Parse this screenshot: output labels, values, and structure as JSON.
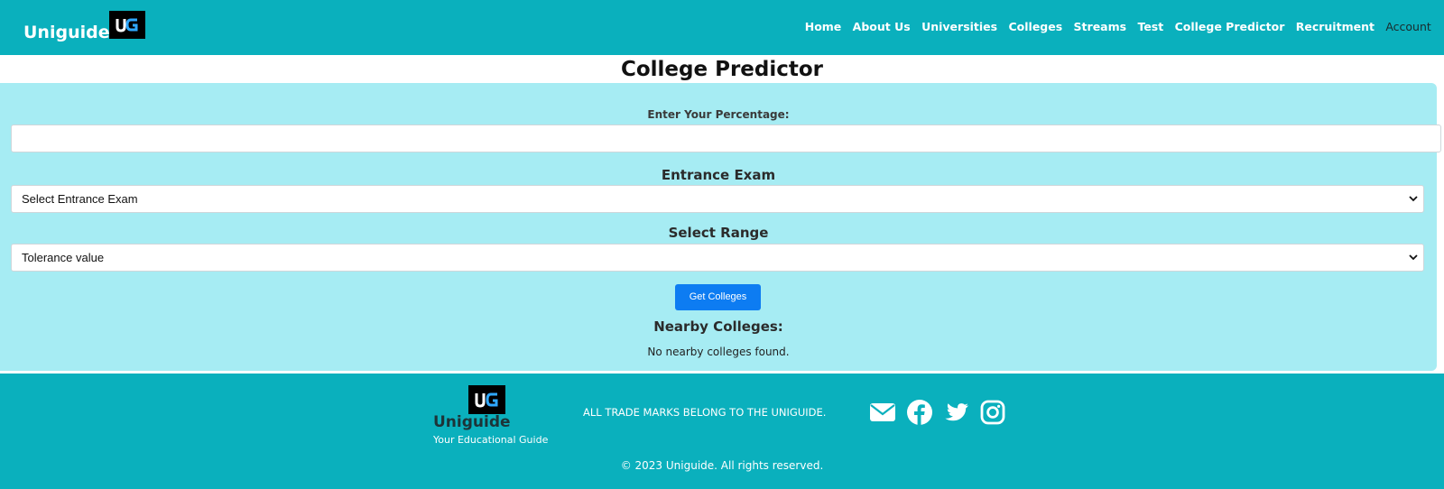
{
  "header": {
    "brand": "Uniguide",
    "logo_text": "UG",
    "nav": [
      "Home",
      "About Us",
      "Universities",
      "Colleges",
      "Streams",
      "Test",
      "College Predictor",
      "Recruitment"
    ],
    "account": "Account"
  },
  "main": {
    "title": "College Predictor",
    "percentage_label": "Enter Your Percentage:",
    "percentage_value": "",
    "exam_label": "Entrance Exam",
    "exam_selected": "Select Entrance Exam",
    "range_label": "Select Range",
    "range_selected": "Tolerance value",
    "submit_label": "Get Colleges",
    "nearby_title": "Nearby Colleges:",
    "nearby_empty": "No nearby colleges found."
  },
  "footer": {
    "logo_text": "UG",
    "brand": "Uniguide",
    "tagline": "Your Educational Guide",
    "trademark": "ALL TRADE MARKS BELONG TO THE UNIGUIDE.",
    "social": [
      "envelope-icon",
      "facebook-icon",
      "twitter-icon",
      "instagram-icon"
    ],
    "copyright": "© 2023 Uniguide. All rights reserved."
  },
  "colors": {
    "brand_teal": "#0ab0bd",
    "panel_cyan": "#a6ecf3",
    "button_blue": "#0d7cf2"
  }
}
